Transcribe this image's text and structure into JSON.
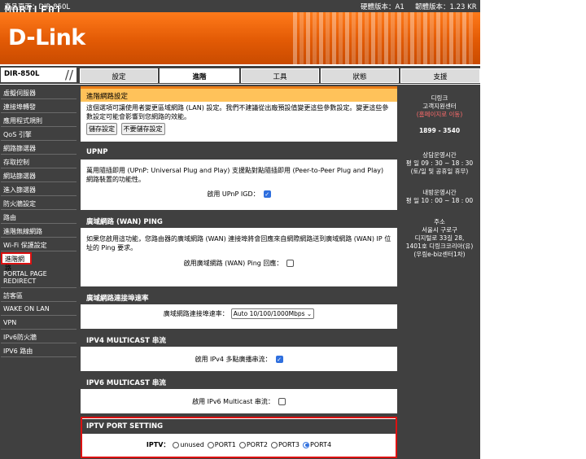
{
  "top_bar": {
    "watermark": "MOBILE01",
    "model": "產品頁面：DIR-850L",
    "hw_version": "硬體版本：A1",
    "fw_version": "韌體版本：1.23 KR"
  },
  "banner": {
    "logo": "D-Link"
  },
  "nav": {
    "model_tag": "DIR-850L",
    "tabs": [
      {
        "label": "設定"
      },
      {
        "label": "進階"
      },
      {
        "label": "工具"
      },
      {
        "label": "狀態"
      },
      {
        "label": "支援"
      }
    ]
  },
  "sidebar": {
    "items": [
      {
        "label": "虛擬伺服器"
      },
      {
        "label": "連接埠轉發"
      },
      {
        "label": "應用程式規則"
      },
      {
        "label": "QoS 引擎"
      },
      {
        "label": "網路篩選器"
      },
      {
        "label": "存取控制"
      },
      {
        "label": "網站篩選器"
      },
      {
        "label": "進入篩選器"
      },
      {
        "label": "防火牆設定"
      },
      {
        "label": "路由"
      },
      {
        "label": "進階無線網路"
      },
      {
        "label": "Wi-Fi 保護設定"
      },
      {
        "label": "進階網路"
      },
      {
        "label": "PORTAL PAGE REDIRECT"
      },
      {
        "label": "訪客區"
      },
      {
        "label": "WAKE ON LAN"
      },
      {
        "label": "VPN"
      },
      {
        "label": "IPv6防火牆"
      },
      {
        "label": "IPV6 路由"
      }
    ]
  },
  "main": {
    "advanced": {
      "title": "進階網路設定",
      "desc": "這個選項可讓使用者變更區域網路 (LAN) 設定。我們不建議從出廠預設值變更這些參數設定。變更這些參數設定可能會影響到您網路的效能。",
      "save_label": "儲存設定",
      "nosave_label": "不要儲存設定"
    },
    "upnp": {
      "title": "UPNP",
      "desc": "萬用隨插即用 (UPnP: Universal Plug and Play) 支援點對點隨插即用 (Peer-to-Peer Plug and Play) 網路裝置的功能性。",
      "field_label": "啟用 UPnP IGD：",
      "checked": true
    },
    "wan_ping": {
      "title": "廣域網路 (WAN) PING",
      "desc": "如果您啟用這功能，您路由器的廣域網路 (WAN) 連接埠將會回應來自網際網路送到廣域網路 (WAN) IP 位址的 Ping 要求。",
      "field_label": "啟用廣域網路 (WAN) Ping 回應：",
      "checked": false
    },
    "wan_speed": {
      "title": "廣域網路連接埠速率",
      "field_label": "廣域網路連接埠速率：",
      "selected": "Auto 10/100/1000Mbps"
    },
    "ipv4_mc": {
      "title": "IPV4 MULTICAST 串流",
      "field_label": "啟用 IPv4 多點廣播串流：",
      "checked": true
    },
    "ipv6_mc": {
      "title": "IPV6 MULTICAST 串流",
      "field_label": "啟用 IPv6 Multicast 串流：",
      "checked": false
    },
    "iptv": {
      "title": "IPTV PORT SETTING",
      "field_label": "IPTV：",
      "options": [
        "unused",
        "PORT1",
        "PORT2",
        "PORT3",
        "PORT4"
      ],
      "selected": "PORT4"
    }
  },
  "right_panel": {
    "company": "디링크",
    "service": "고객지원센터",
    "homepage": "(홈페이지로 이동)",
    "phone": "1899 - 3540",
    "consult_title": "상담운영시간",
    "consult_hours": "평 일  09 : 30 ~ 18 : 30",
    "consult_note": "(토/일 및 공휴일 휴무)",
    "visit_title": "내방운영시간",
    "visit_hours": "평 일  10 : 00 ~ 18 : 00",
    "addr_title": "주소",
    "addr_1": "서울시 구로구",
    "addr_2": "디지털로 33길 28,",
    "addr_3": "1401호 디링크코리아(유)",
    "addr_4": "(우림e-biz센터1차)"
  }
}
